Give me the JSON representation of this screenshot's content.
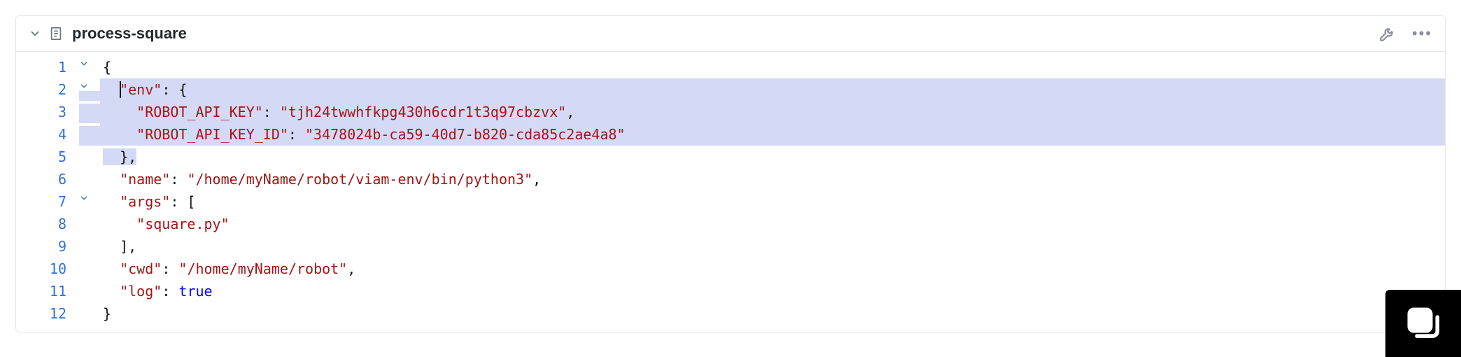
{
  "header": {
    "title": "process-square"
  },
  "code": {
    "lines": [
      {
        "num": "1",
        "fold": "v",
        "hl": false,
        "indent": "",
        "tokens": [
          {
            "t": "{",
            "c": "punc"
          }
        ]
      },
      {
        "num": "2",
        "fold": "v",
        "hl": true,
        "indent": "  ",
        "caret": true,
        "tokens": [
          {
            "t": "\"env\"",
            "c": "key"
          },
          {
            "t": ": {",
            "c": "punc"
          }
        ]
      },
      {
        "num": "3",
        "fold": "",
        "hl": true,
        "indent": "    ",
        "tokens": [
          {
            "t": "\"ROBOT_API_KEY\"",
            "c": "key"
          },
          {
            "t": ": ",
            "c": "punc"
          },
          {
            "t": "\"tjh24twwhfkpg430h6cdr1t3q97cbzvx\"",
            "c": "str"
          },
          {
            "t": ",",
            "c": "punc"
          }
        ]
      },
      {
        "num": "4",
        "fold": "",
        "hl": true,
        "indent": "    ",
        "tokens": [
          {
            "t": "\"ROBOT_API_KEY_ID\"",
            "c": "key"
          },
          {
            "t": ": ",
            "c": "punc"
          },
          {
            "t": "\"3478024b-ca59-40d7-b820-cda85c2ae4a8\"",
            "c": "str"
          }
        ]
      },
      {
        "num": "5",
        "fold": "",
        "hl": true,
        "indent": "  ",
        "partial": true,
        "tokens": [
          {
            "t": "},",
            "c": "punc"
          }
        ]
      },
      {
        "num": "6",
        "fold": "",
        "hl": false,
        "indent": "  ",
        "tokens": [
          {
            "t": "\"name\"",
            "c": "key"
          },
          {
            "t": ": ",
            "c": "punc"
          },
          {
            "t": "\"/home/myName/robot/viam-env/bin/python3\"",
            "c": "str"
          },
          {
            "t": ",",
            "c": "punc"
          }
        ]
      },
      {
        "num": "7",
        "fold": "v",
        "hl": false,
        "indent": "  ",
        "tokens": [
          {
            "t": "\"args\"",
            "c": "key"
          },
          {
            "t": ": [",
            "c": "punc"
          }
        ]
      },
      {
        "num": "8",
        "fold": "",
        "hl": false,
        "indent": "    ",
        "tokens": [
          {
            "t": "\"square.py\"",
            "c": "str"
          }
        ]
      },
      {
        "num": "9",
        "fold": "",
        "hl": false,
        "indent": "  ",
        "tokens": [
          {
            "t": "],",
            "c": "punc"
          }
        ]
      },
      {
        "num": "10",
        "fold": "",
        "hl": false,
        "indent": "  ",
        "tokens": [
          {
            "t": "\"cwd\"",
            "c": "key"
          },
          {
            "t": ": ",
            "c": "punc"
          },
          {
            "t": "\"/home/myName/robot\"",
            "c": "str"
          },
          {
            "t": ",",
            "c": "punc"
          }
        ]
      },
      {
        "num": "11",
        "fold": "",
        "hl": false,
        "indent": "  ",
        "tokens": [
          {
            "t": "\"log\"",
            "c": "key"
          },
          {
            "t": ": ",
            "c": "punc"
          },
          {
            "t": "true",
            "c": "bool"
          }
        ]
      },
      {
        "num": "12",
        "fold": "",
        "hl": false,
        "indent": "",
        "tokens": [
          {
            "t": "}",
            "c": "punc"
          }
        ]
      }
    ]
  }
}
